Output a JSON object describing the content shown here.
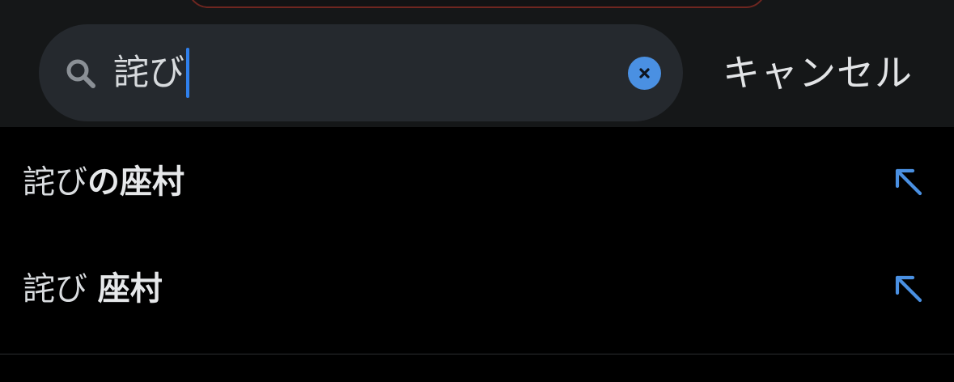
{
  "search": {
    "query": "詫び",
    "icon": "search-icon",
    "clear_icon": "close-icon"
  },
  "header": {
    "cancel_label": "キャンセル"
  },
  "suggestions": [
    {
      "prefix": "詫び",
      "completion": "の座村",
      "icon": "arrow-up-left-icon"
    },
    {
      "prefix": "詫び ",
      "completion": "座村",
      "icon": "arrow-up-left-icon"
    }
  ],
  "colors": {
    "background": "#000000",
    "header_background": "#151718",
    "search_field": "#25292e",
    "accent": "#4a90e2",
    "caret": "#2f80ed"
  }
}
